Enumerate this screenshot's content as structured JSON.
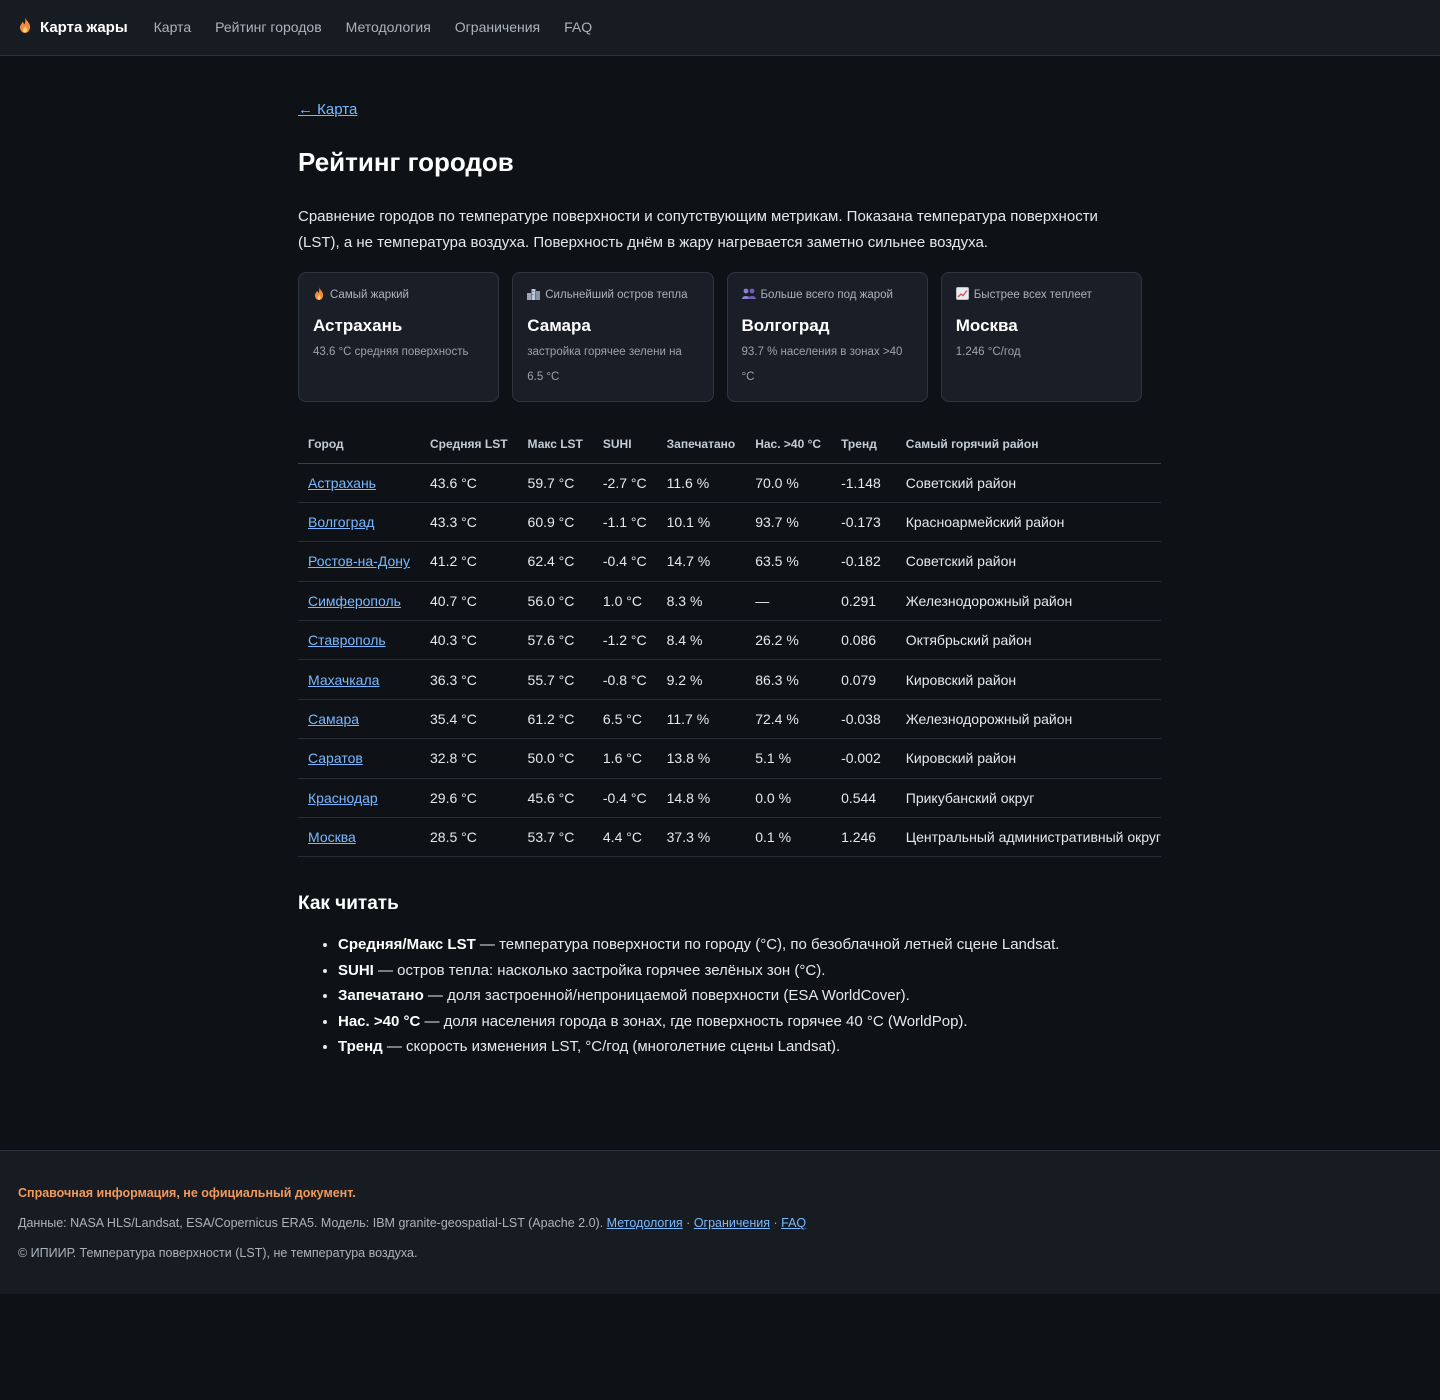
{
  "nav": {
    "brand": "Карта жары",
    "links": [
      "Карта",
      "Рейтинг городов",
      "Методология",
      "Ограничения",
      "FAQ"
    ]
  },
  "back": "← Карта",
  "title": "Рейтинг городов",
  "intro": "Сравнение городов по температуре поверхности и сопутствующим метрикам. Показана температура поверхности (LST), а не температура воздуха. Поверхность днём в жару нагревается заметно сильнее воздуха.",
  "cards": [
    {
      "icon": "fire-icon",
      "label": "Самый жаркий",
      "city": "Астрахань",
      "sub": "43.6 °C средняя поверхность"
    },
    {
      "icon": "city-icon",
      "label": "Сильнейший остров тепла",
      "city": "Самара",
      "sub": "застройка горячее зелени на 6.5 °C"
    },
    {
      "icon": "people-icon",
      "label": "Больше всего под жарой",
      "city": "Волгоград",
      "sub": "93.7 % населения в зонах >40 °C"
    },
    {
      "icon": "trend-up-icon",
      "label": "Быстрее всех теплеет",
      "city": "Москва",
      "sub": "1.246 °C/год"
    }
  ],
  "table": {
    "headers": [
      "Город",
      "Средняя LST",
      "Макс LST",
      "SUHI",
      "Запечатано",
      "Нас. >40 °C",
      "Тренд",
      "Самый горячий район"
    ],
    "rows": [
      [
        "Астрахань",
        "43.6 °C",
        "59.7 °C",
        "-2.7 °C",
        "11.6 %",
        "70.0 %",
        "-1.148",
        "Советский район"
      ],
      [
        "Волгоград",
        "43.3 °C",
        "60.9 °C",
        "-1.1 °C",
        "10.1 %",
        "93.7 %",
        "-0.173",
        "Красноармейский район"
      ],
      [
        "Ростов-на-Дону",
        "41.2 °C",
        "62.4 °C",
        "-0.4 °C",
        "14.7 %",
        "63.5 %",
        "-0.182",
        "Советский район"
      ],
      [
        "Симферополь",
        "40.7 °C",
        "56.0 °C",
        "1.0 °C",
        "8.3 %",
        "—",
        "0.291",
        "Железнодорожный район"
      ],
      [
        "Ставрополь",
        "40.3 °C",
        "57.6 °C",
        "-1.2 °C",
        "8.4 %",
        "26.2 %",
        "0.086",
        "Октябрьский район"
      ],
      [
        "Махачкала",
        "36.3 °C",
        "55.7 °C",
        "-0.8 °C",
        "9.2 %",
        "86.3 %",
        "0.079",
        "Кировский район"
      ],
      [
        "Самара",
        "35.4 °C",
        "61.2 °C",
        "6.5 °C",
        "11.7 %",
        "72.4 %",
        "-0.038",
        "Железнодорожный район"
      ],
      [
        "Саратов",
        "32.8 °C",
        "50.0 °C",
        "1.6 °C",
        "13.8 %",
        "5.1 %",
        "-0.002",
        "Кировский район"
      ],
      [
        "Краснодар",
        "29.6 °C",
        "45.6 °C",
        "-0.4 °C",
        "14.8 %",
        "0.0 %",
        "0.544",
        "Прикубанский округ"
      ],
      [
        "Москва",
        "28.5 °C",
        "53.7 °C",
        "4.4 °C",
        "37.3 %",
        "0.1 %",
        "1.246",
        "Центральный административный округ"
      ]
    ]
  },
  "howto": {
    "title": "Как читать",
    "items": [
      {
        "term": "Средняя/Макс LST",
        "desc": " — температура поверхности по городу (°C), по безоблачной летней сцене Landsat."
      },
      {
        "term": "SUHI",
        "desc": " — остров тепла: насколько застройка горячее зелёных зон (°C)."
      },
      {
        "term": "Запечатано",
        "desc": " — доля застроенной/непроницаемой поверхности (ESA WorldCover)."
      },
      {
        "term": "Нас. >40 °C",
        "desc": " — доля населения города в зонах, где поверхность горячее 40 °C (WorldPop)."
      },
      {
        "term": "Тренд",
        "desc": " — скорость изменения LST, °C/год (многолетние сцены Landsat)."
      }
    ]
  },
  "footer": {
    "warning": "Справочная информация, не официальный документ.",
    "sources": "Данные: NASA HLS/Landsat, ESA/Copernicus ERA5. Модель: IBM granite-geospatial-LST (Apache 2.0). ",
    "links": [
      "Методология",
      "Ограничения",
      "FAQ"
    ],
    "sep": " · ",
    "copyright": "© ИПИИР. Температура поверхности (LST), не температура воздуха."
  },
  "colors": {
    "accent": "#79b8ff",
    "warning": "#f2995b",
    "background": "#0e1217",
    "panel": "#171c23"
  }
}
